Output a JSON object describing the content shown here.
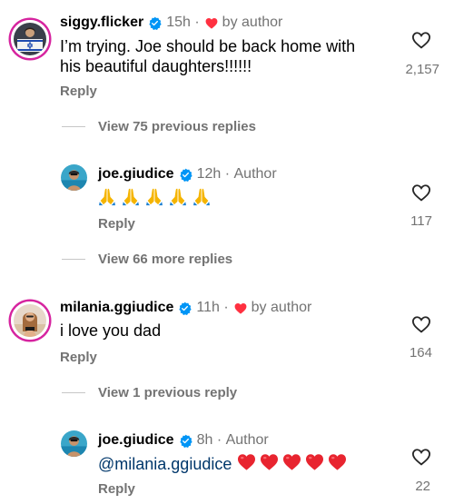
{
  "comments": [
    {
      "username": "siggy.flicker",
      "time": "15h",
      "liked_by_author_label": "by author",
      "text_line1": "I’m trying.  Joe should be back home with",
      "text_line2": "his beautiful daughters!!!!!!",
      "reply_label": "Reply",
      "like_count": "2,157"
    },
    {
      "view_replies_label": "View 75 previous replies"
    },
    {
      "username": "joe.giudice",
      "time": "12h",
      "author_label": "Author",
      "emoji": "folded-hands x5",
      "reply_label": "Reply",
      "like_count": "117"
    },
    {
      "view_more_label": "View 66 more replies"
    },
    {
      "username": "milania.ggiudice",
      "time": "11h",
      "liked_by_author_label": "by author",
      "text": "i love you dad",
      "reply_label": "Reply",
      "like_count": "164"
    },
    {
      "view_previous_label": "View 1 previous reply"
    },
    {
      "username": "joe.giudice",
      "time": "8h",
      "author_label": "Author",
      "mention": "@milania.ggiudice",
      "emoji": "red-heart x5",
      "reply_label": "Reply",
      "like_count": "22"
    }
  ],
  "colors": {
    "muted": "#737373",
    "verified": "#0095f6",
    "heart": "#ff3040",
    "mention": "#00376b",
    "story_ring": "#d6249f"
  }
}
